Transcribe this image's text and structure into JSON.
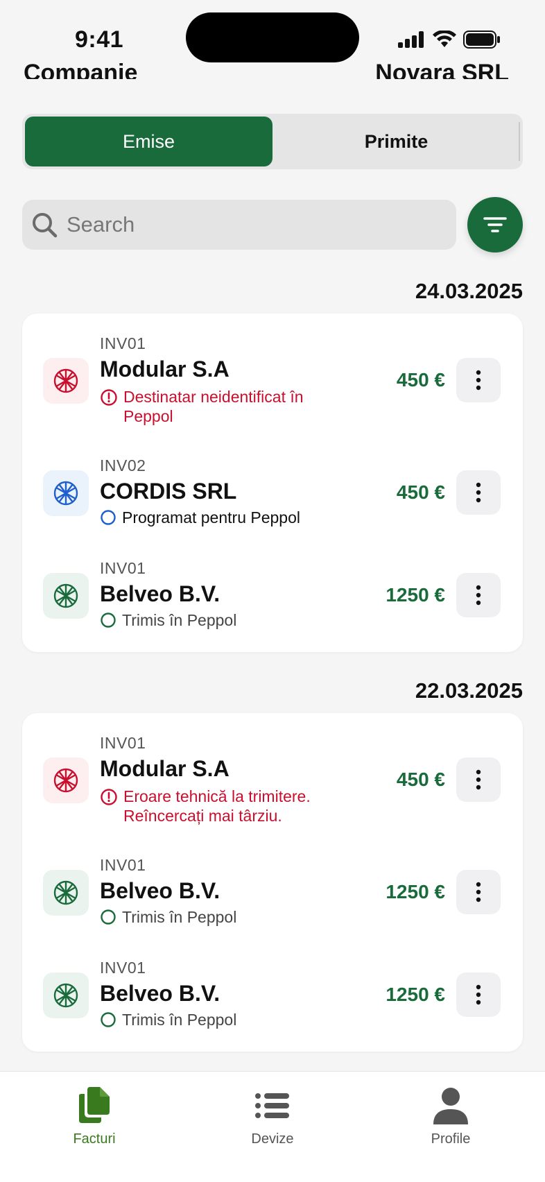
{
  "status_bar": {
    "time": "9:41"
  },
  "header": {
    "left_text": "Companie",
    "right_text": "Novara SRL"
  },
  "segment": {
    "issued_label": "Emise",
    "received_label": "Primite"
  },
  "search": {
    "placeholder": "Search"
  },
  "groups": [
    {
      "date": "24.03.2025",
      "invoices": [
        {
          "number": "INV01",
          "company": "Modular S.A",
          "status_line1": "Destinatar neidentificat în",
          "status_line2": "Peppol",
          "amount": "450 €"
        },
        {
          "number": "INV02",
          "company": "CORDIS SRL",
          "status_line1": "Programat pentru Peppol",
          "amount": "450 €"
        },
        {
          "number": "INV01",
          "company": "Belveo B.V.",
          "status_line1": "Trimis în Peppol",
          "amount": "1250 €"
        }
      ]
    },
    {
      "date": "22.03.2025",
      "invoices": [
        {
          "number": "INV01",
          "company": "Modular S.A",
          "status_line1": "Eroare tehnică la trimitere.",
          "status_line2": "Reîncercați mai târziu.",
          "amount": "450 €"
        },
        {
          "number": "INV01",
          "company": "Belveo B.V.",
          "status_line1": "Trimis în Peppol",
          "amount": "1250 €"
        },
        {
          "number": "INV01",
          "company": "Belveo B.V.",
          "status_line1": "Trimis în Peppol",
          "amount": "1250 €"
        }
      ]
    }
  ],
  "tabbar": {
    "tabs": [
      {
        "label": "Facturi",
        "icon": "documents-icon",
        "active": true
      },
      {
        "label": "Devize",
        "icon": "list-icon",
        "active": false
      },
      {
        "label": "Profile",
        "icon": "person-icon",
        "active": false
      }
    ]
  },
  "colors": {
    "brand_green": "#1a6b3c",
    "error_red": "#c8102e",
    "scheduled_blue": "#1e5fcc",
    "tab_active": "#3a7a1e"
  }
}
